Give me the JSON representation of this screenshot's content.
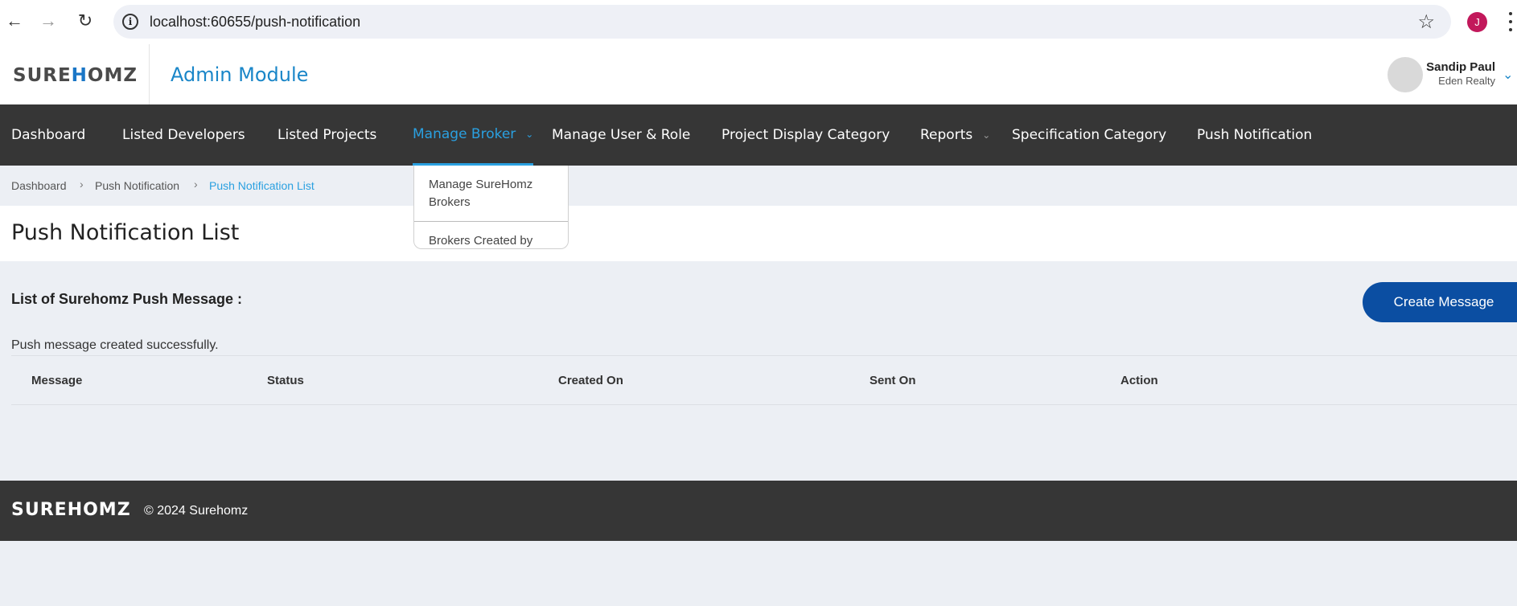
{
  "browser": {
    "url": "localhost:60655/push-notification",
    "profile_initial": "J"
  },
  "header": {
    "logo_pre": "SURE",
    "logo_h": "H",
    "logo_post": "OMZ",
    "module_title": "Admin Module",
    "user_name": "Sandip Paul",
    "user_org": "Eden Realty"
  },
  "nav": {
    "items": [
      {
        "label": "Dashboard"
      },
      {
        "label": "Listed Developers"
      },
      {
        "label": "Listed Projects"
      },
      {
        "label": "Manage Broker"
      },
      {
        "label": "Manage User & Role"
      },
      {
        "label": "Project Display Category"
      },
      {
        "label": "Reports"
      },
      {
        "label": "Specification Category"
      },
      {
        "label": "Push Notification"
      }
    ],
    "dropdown": [
      "Manage SureHomz Brokers",
      "Brokers Created by"
    ]
  },
  "breadcrumb": [
    "Dashboard",
    "Push Notification",
    "Push Notification List"
  ],
  "page": {
    "title": "Push Notification List",
    "section_heading": "List of Surehomz Push Message :",
    "create_button": "Create Message",
    "success_message": "Push message created successfully.",
    "table_headers": [
      "Message",
      "Status",
      "Created On",
      "Sent On",
      "Action"
    ]
  },
  "footer": {
    "copyright": "© 2024 Surehomz"
  },
  "colors": {
    "accent": "#2aa0e0",
    "nav_bg": "#363636",
    "button_bg": "#0b4ea2"
  }
}
